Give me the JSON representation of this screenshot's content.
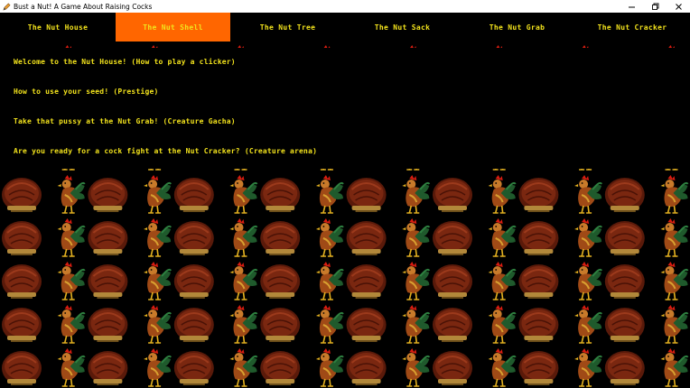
{
  "window": {
    "title": "Bust a Nut! A Game About Raising Cocks",
    "controls": [
      "minimize-icon",
      "restore-icon",
      "close-icon"
    ]
  },
  "tabs": [
    {
      "label": "The Nut House",
      "active": false
    },
    {
      "label": "The Nut Shell",
      "active": true
    },
    {
      "label": "The Nut Tree",
      "active": false
    },
    {
      "label": "The Nut Sack",
      "active": false
    },
    {
      "label": "The Nut Grab",
      "active": false
    },
    {
      "label": "The Nut Cracker",
      "active": false
    }
  ],
  "content": {
    "lines": [
      "Welcome to the Nut House! (How to play a clicker)",
      "How to use your seed! (Prestige)",
      "Take that pussy at the Nut Grab! (Creature Gacha)",
      "Are you ready for a cock fight at the Nut Cracker? (Creature arena)"
    ]
  },
  "background_pattern": {
    "icons": [
      "chestnut-icon",
      "rooster-icon"
    ]
  },
  "colors": {
    "text": "#f2e21c",
    "active_tab": "#ff6600",
    "background": "#000000"
  }
}
